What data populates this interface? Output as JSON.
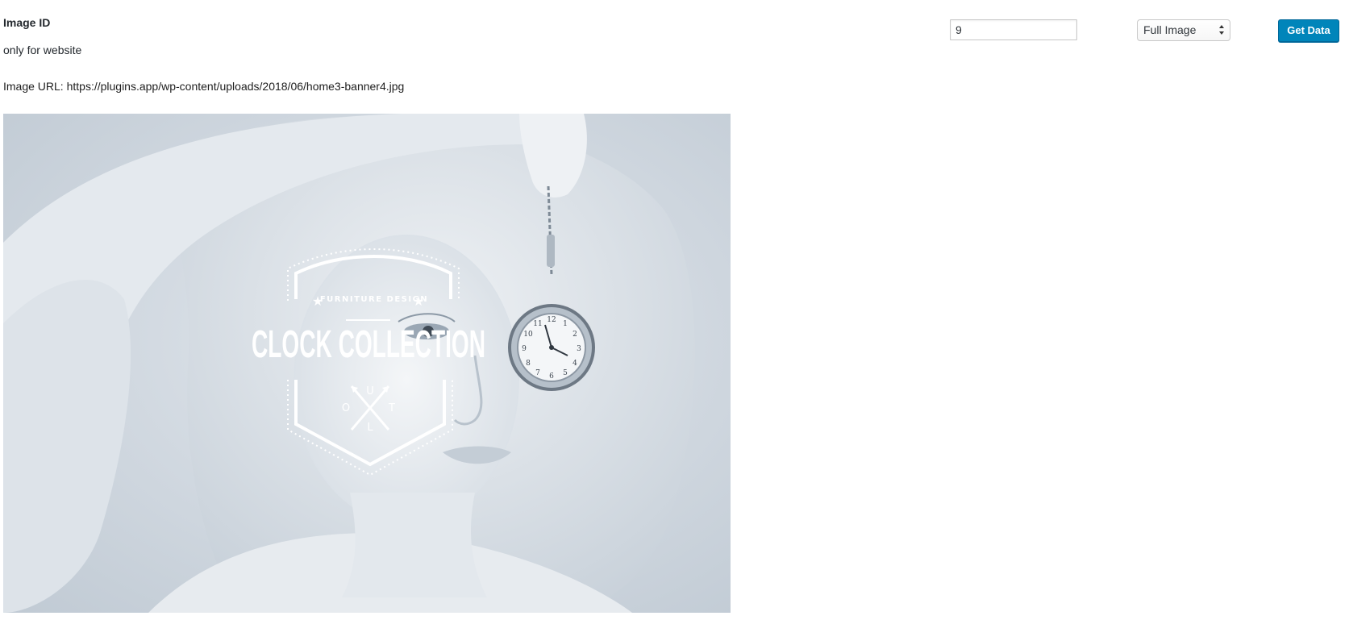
{
  "field": {
    "label": "Image ID",
    "description": "only for website"
  },
  "form": {
    "id_value": "9",
    "size_selected": "Full Image",
    "submit_label": "Get Data"
  },
  "result": {
    "url_line": "Image URL: https://plugins.app/wp-content/uploads/2018/06/home3-banner4.jpg"
  },
  "banner": {
    "logo_top": "FURNITURE DESIGN",
    "logo_title": "CLOCK COLLECTION",
    "logo_letters": [
      "U",
      "O",
      "T",
      "L"
    ],
    "clock_numbers": [
      "12",
      "1",
      "2",
      "3",
      "4",
      "5",
      "6",
      "7",
      "8",
      "9",
      "10",
      "11"
    ]
  },
  "colors": {
    "button_bg": "#0085ba",
    "photo_tint": "#cfd6de"
  }
}
